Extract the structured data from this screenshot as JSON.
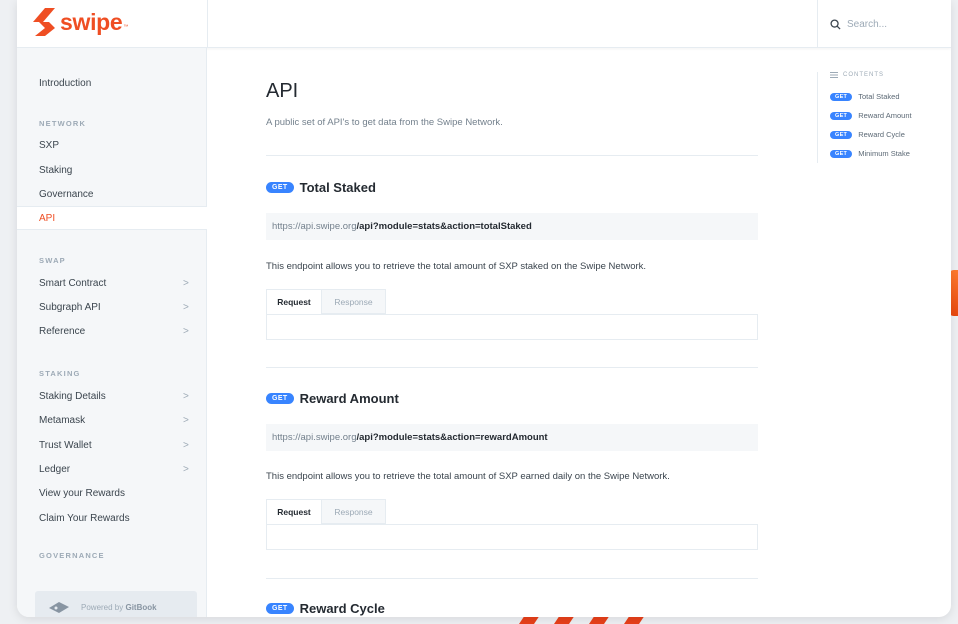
{
  "brand": {
    "name": "swipe",
    "tm": "™",
    "color": "#ef4e23"
  },
  "search": {
    "placeholder": "Search..."
  },
  "sidebar": {
    "items": [
      {
        "label": "Introduction"
      },
      {
        "section": "NETWORK"
      },
      {
        "label": "SXP"
      },
      {
        "label": "Staking"
      },
      {
        "label": "Governance"
      },
      {
        "label": "API",
        "active": true
      },
      {
        "section": "SWAP"
      },
      {
        "label": "Smart Contract",
        "chevron": true
      },
      {
        "label": "Subgraph API",
        "chevron": true
      },
      {
        "label": "Reference",
        "chevron": true
      },
      {
        "section": "STAKING"
      },
      {
        "label": "Staking Details",
        "chevron": true
      },
      {
        "label": "Metamask",
        "chevron": true
      },
      {
        "label": "Trust Wallet",
        "chevron": true
      },
      {
        "label": "Ledger",
        "chevron": true
      },
      {
        "label": "View your Rewards"
      },
      {
        "label": "Claim Your Rewards"
      },
      {
        "section": "GOVERNANCE"
      }
    ],
    "chevron_glyph": ">",
    "powered_prefix": "Powered by ",
    "powered_brand": "GitBook"
  },
  "page": {
    "title": "API",
    "description": "A public set of API's to get data from the Swipe Network."
  },
  "endpoints": [
    {
      "method": "GET",
      "title": "Total Staked",
      "url_base": "https://api.swipe.org",
      "url_path": "/api?module=stats&action=totalStaked",
      "description": "This endpoint allows you to retrieve the total amount of SXP staked on the Swipe Network.",
      "tab_request": "Request",
      "tab_response": "Response"
    },
    {
      "method": "GET",
      "title": "Reward Amount",
      "url_base": "https://api.swipe.org",
      "url_path": "/api?module=stats&action=rewardAmount",
      "description": "This endpoint allows you to retrieve the total amount of SXP earned daily on the Swipe Network.",
      "tab_request": "Request",
      "tab_response": "Response"
    },
    {
      "method": "GET",
      "title": "Reward Cycle"
    }
  ],
  "toc": {
    "header": "CONTENTS",
    "items": [
      {
        "method": "GET",
        "label": "Total Staked"
      },
      {
        "method": "GET",
        "label": "Reward Amount"
      },
      {
        "method": "GET",
        "label": "Reward Cycle"
      },
      {
        "method": "GET",
        "label": "Minimum Stake"
      }
    ]
  },
  "colors": {
    "accent": "#ef4e23",
    "get_badge": "#3884ff"
  }
}
